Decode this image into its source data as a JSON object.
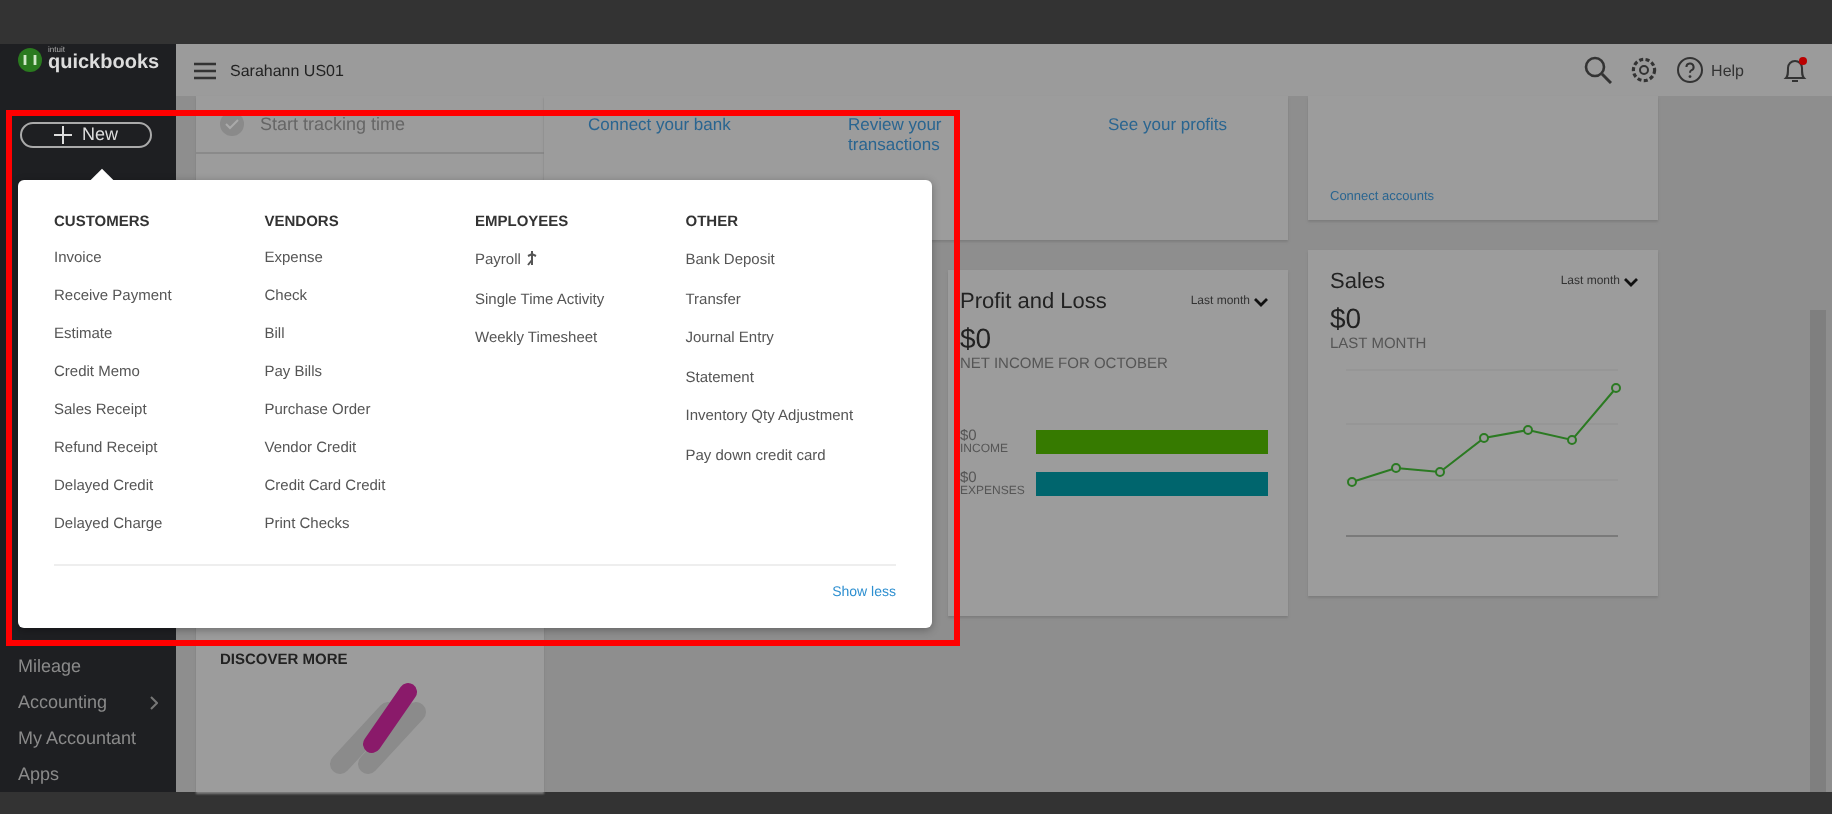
{
  "sidebar": {
    "brand_small": "intuit",
    "brand": "quickbooks",
    "new_button": "New",
    "items": [
      {
        "label": "Mileage",
        "submenu": false
      },
      {
        "label": "Accounting",
        "submenu": true
      },
      {
        "label": "My Accountant",
        "submenu": false
      },
      {
        "label": "Apps",
        "submenu": false
      }
    ]
  },
  "header": {
    "company": "Sarahann US01",
    "help": "Help",
    "notification": true
  },
  "content": {
    "task": "Start tracking time",
    "discover": "DISCOVER MORE",
    "links": [
      "Connect your bank",
      "Review your transactions",
      "See your profits"
    ],
    "connect_accounts": "Connect accounts",
    "profit_loss": {
      "title": "Profit and Loss",
      "period": "Last month",
      "amount": "$0",
      "caption": "NET INCOME FOR OCTOBER",
      "bars": [
        {
          "amount": "$0",
          "label": "INCOME",
          "color": "#367a00"
        },
        {
          "amount": "$0",
          "label": "EXPENSES",
          "color": "#00656d"
        }
      ]
    },
    "sales": {
      "title": "Sales",
      "period": "Last month",
      "amount": "$0",
      "caption": "LAST MONTH"
    }
  },
  "new_menu": {
    "columns": [
      {
        "heading": "CUSTOMERS",
        "items": [
          {
            "label": "Invoice",
            "flag": false
          },
          {
            "label": "Receive Payment",
            "flag": false
          },
          {
            "label": "Estimate",
            "flag": false
          },
          {
            "label": "Credit Memo",
            "flag": false
          },
          {
            "label": "Sales Receipt",
            "flag": false
          },
          {
            "label": "Refund Receipt",
            "flag": false
          },
          {
            "label": "Delayed Credit",
            "flag": false
          },
          {
            "label": "Delayed Charge",
            "flag": false
          }
        ]
      },
      {
        "heading": "VENDORS",
        "items": [
          {
            "label": "Expense",
            "flag": false
          },
          {
            "label": "Check",
            "flag": false
          },
          {
            "label": "Bill",
            "flag": false
          },
          {
            "label": "Pay Bills",
            "flag": false
          },
          {
            "label": "Purchase Order",
            "flag": false
          },
          {
            "label": "Vendor Credit",
            "flag": false
          },
          {
            "label": "Credit Card Credit",
            "flag": false
          },
          {
            "label": "Print Checks",
            "flag": false
          }
        ]
      },
      {
        "heading": "EMPLOYEES",
        "items": [
          {
            "label": "Payroll",
            "flag": true
          },
          {
            "label": "Single Time Activity",
            "flag": false
          },
          {
            "label": "Weekly Timesheet",
            "flag": false
          }
        ]
      },
      {
        "heading": "OTHER",
        "items": [
          {
            "label": "Bank Deposit",
            "flag": false
          },
          {
            "label": "Transfer",
            "flag": false
          },
          {
            "label": "Journal Entry",
            "flag": false
          },
          {
            "label": "Statement",
            "flag": false
          },
          {
            "label": "Inventory Qty Adjustment",
            "flag": false
          },
          {
            "label": "Pay down credit card",
            "flag": false
          }
        ]
      }
    ],
    "footer_link": "Show less"
  }
}
